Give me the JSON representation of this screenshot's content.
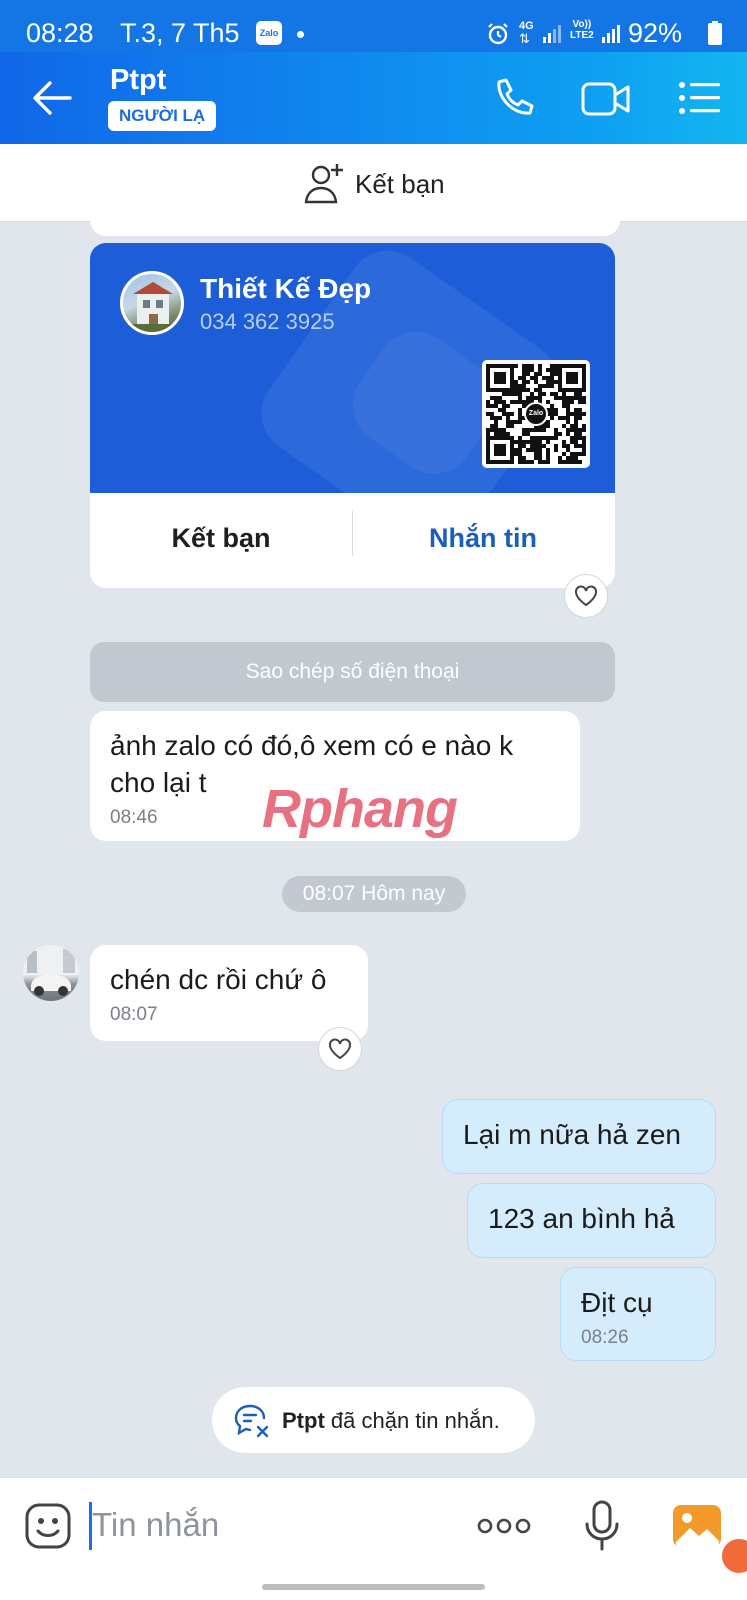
{
  "status_bar": {
    "time": "08:28",
    "date": "T.3, 7 Th5",
    "app_badge": "Zalo",
    "network_4g": "4G",
    "volte_line1": "Vo))",
    "volte_line2": "LTE2",
    "battery": "92%"
  },
  "header": {
    "contact_name": "Ptpt",
    "badge": "NGƯỜI LẠ",
    "icons": [
      "back-arrow-icon",
      "phone-icon",
      "video-call-icon",
      "menu-list-icon"
    ]
  },
  "friend_bar": {
    "label": "Kết bạn",
    "icon": "add-friend-icon"
  },
  "contact_card": {
    "name": "Thiết Kế Đẹp",
    "phone": "034 362 3925",
    "qr_logo": "Zalo",
    "add_friend_label": "Kết bạn",
    "message_label": "Nhắn tin",
    "accent_color": "#1d5ed8"
  },
  "copy_phone_label": "Sao chép số điện thoại",
  "messages": [
    {
      "side": "incoming",
      "text": "ảnh zalo có đó,ô xem có e nào k cho lại t",
      "time": "08:46"
    },
    {
      "side": "incoming",
      "text": "chén dc rồi chứ ô",
      "time": "08:07"
    },
    {
      "side": "outgoing",
      "text": "Lại m nữa hả zen"
    },
    {
      "side": "outgoing",
      "text": "123 an bình hả"
    },
    {
      "side": "outgoing",
      "text": "Địt cụ",
      "time": "08:26"
    }
  ],
  "date_separator": "08:07 Hôm nay",
  "watermark": "Rphang",
  "blocked_notice": {
    "name": "Ptpt",
    "text": "đã chặn tin nhắn."
  },
  "input_bar": {
    "placeholder": "Tin nhắn",
    "icons": [
      "emoji-icon",
      "more-dots-icon",
      "microphone-icon",
      "image-gallery-icon"
    ]
  },
  "colors": {
    "header_start": "#1167e8",
    "header_end": "#13b6f0",
    "chat_background": "#e1e6ed",
    "outgoing_bubble": "#d4ecfc",
    "link_blue": "#1b5fb8"
  }
}
